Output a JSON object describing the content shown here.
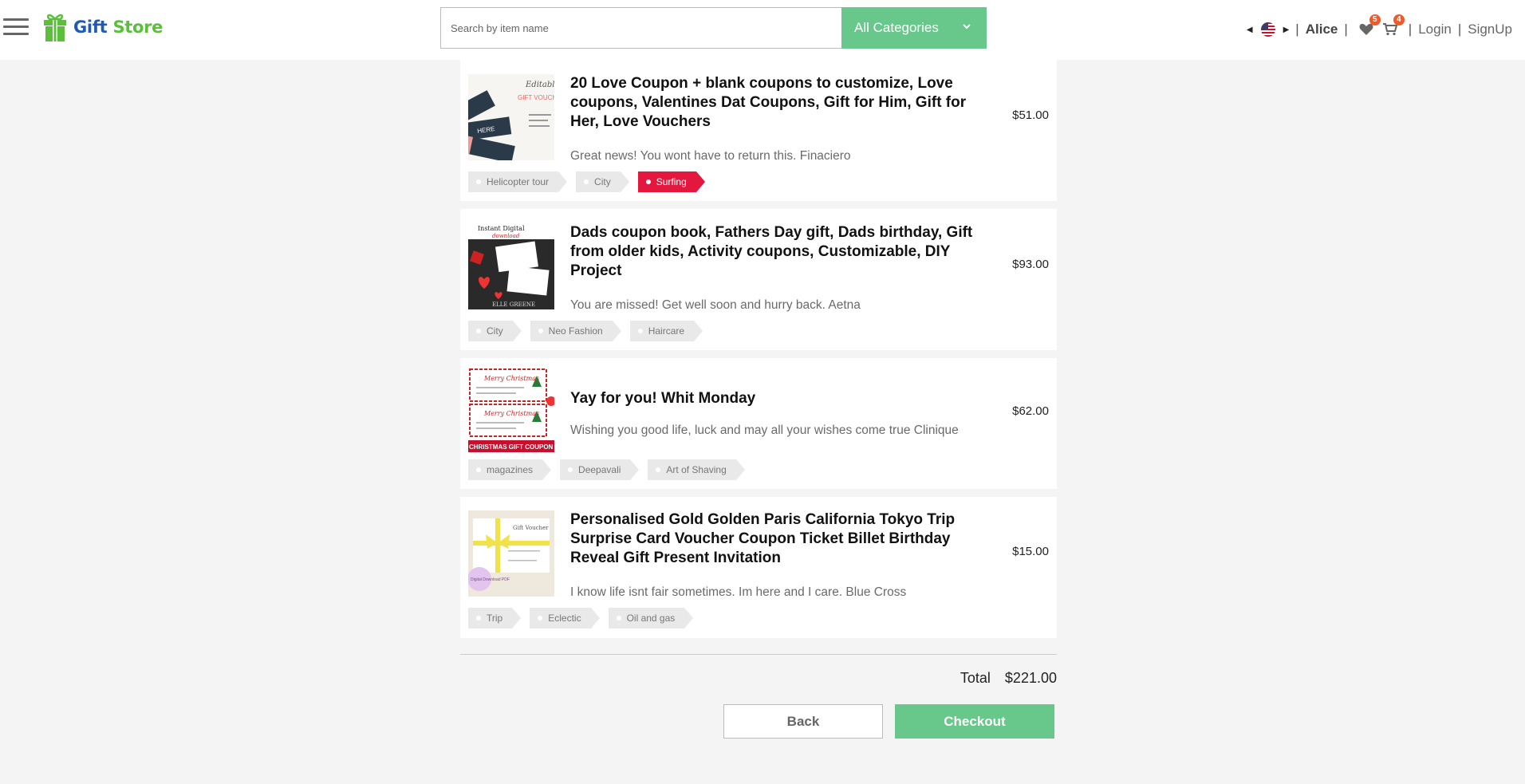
{
  "header": {
    "logo": {
      "word1": "Gift",
      "word2": "Store"
    },
    "search": {
      "placeholder": "Search by item name",
      "value": ""
    },
    "category_select": {
      "selected": "All Categories"
    },
    "user_name": "Alice",
    "wishlist_count": "5",
    "cart_count": "4",
    "login_label": "Login",
    "signup_label": "SignUp",
    "separator": "|"
  },
  "cart": {
    "items": [
      {
        "title": "20 Love Coupon + blank coupons to customize, Love coupons, Valentines Dat Coupons, Gift for Him, Gift for Her, Love Vouchers",
        "price": "$51.00",
        "description": "Great news! You wont have to return this. Finaciero",
        "tags": [
          {
            "label": "Helicopter tour",
            "active": false
          },
          {
            "label": "City",
            "active": false
          },
          {
            "label": "Surfing",
            "active": true
          }
        ]
      },
      {
        "title": "Dads coupon book, Fathers Day gift, Dads birthday, Gift from older kids, Activity coupons, Customizable, DIY Project",
        "price": "$93.00",
        "description": "You are missed! Get well soon and hurry back. Aetna",
        "tags": [
          {
            "label": "City",
            "active": false
          },
          {
            "label": "Neo Fashion",
            "active": false
          },
          {
            "label": "Haircare",
            "active": false
          }
        ]
      },
      {
        "title": "Yay for you! Whit Monday",
        "price": "$62.00",
        "description": "Wishing you good life, luck and may all your wishes come true Clinique",
        "tags": [
          {
            "label": "magazines",
            "active": false
          },
          {
            "label": "Deepavali",
            "active": false
          },
          {
            "label": "Art of Shaving",
            "active": false
          }
        ]
      },
      {
        "title": "Personalised Gold Golden Paris California Tokyo Trip Surprise Card Voucher Coupon Ticket Billet Birthday Reveal Gift Present Invitation",
        "price": "$15.00",
        "description": "I know life isnt fair sometimes. Im here and I care. Blue Cross",
        "tags": [
          {
            "label": "Trip",
            "active": false
          },
          {
            "label": "Eclectic",
            "active": false
          },
          {
            "label": "Oil and gas",
            "active": false
          }
        ]
      }
    ],
    "total_label": "Total",
    "total_value": "$221.00",
    "back_label": "Back",
    "checkout_label": "Checkout"
  },
  "thumbnails": {
    "item1": {
      "script_text": "Editable",
      "headline": "GIFT VOUCHER",
      "ticket_text": "HERE"
    },
    "item2": {
      "banner_top": "Instant Digital",
      "banner_sub": "download",
      "footer": "ELLE GREENE"
    },
    "item3": {
      "card_text": "Merry Christmas",
      "footer": "CHRISTMAS GIFT COUPON"
    },
    "item4": {
      "card_title": "Gift Voucher",
      "stamp_text": "Digital Download PDF"
    }
  },
  "colors": {
    "accent_green": "#68c78b",
    "tag_active": "#e4173e",
    "badge": "#f05a28",
    "logo_blue": "#1f5bb3",
    "logo_green": "#5bbf3c"
  },
  "icons": [
    "hamburger-menu-icon",
    "gift-logo-icon",
    "chevron-down-icon",
    "caret-left-icon",
    "us-flag-icon",
    "caret-right-icon",
    "heart-icon",
    "cart-icon"
  ]
}
